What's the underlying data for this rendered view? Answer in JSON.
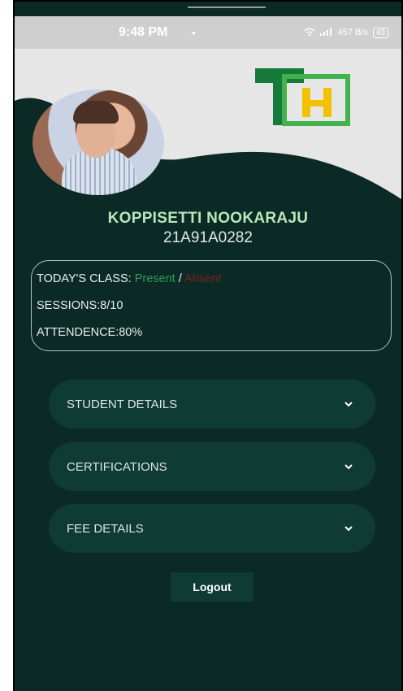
{
  "status_bar": {
    "time": "9:48 PM",
    "dot": "•",
    "net_speed": "457 B/s",
    "battery": "43"
  },
  "profile": {
    "name": "KOPPISETTI NOOKARAJU",
    "roll_number": "21A91A0282"
  },
  "logo": {
    "text": "TH",
    "colors": {
      "green": "#27a844",
      "yellow": "#f2c200"
    }
  },
  "summary": {
    "todays_class_label": "TODAY'S CLASS: ",
    "present": "Present",
    "separator": " / ",
    "absent": "Absent",
    "sessions": "SESSIONS:8/10",
    "attendance": "ATTENDENCE:80%"
  },
  "sections": [
    {
      "label": "STUDENT DETAILS",
      "icon": "chevron-down-icon"
    },
    {
      "label": "CERTIFICATIONS",
      "icon": "chevron-down-icon"
    },
    {
      "label": "FEE DETAILS",
      "icon": "chevron-down-icon"
    }
  ],
  "logout_label": "Logout",
  "colors": {
    "background": "#0b2a26",
    "card": "#0f3b35",
    "present": "#2f9a57",
    "absent": "#7a1f1f",
    "name": "#b9e7b9"
  }
}
